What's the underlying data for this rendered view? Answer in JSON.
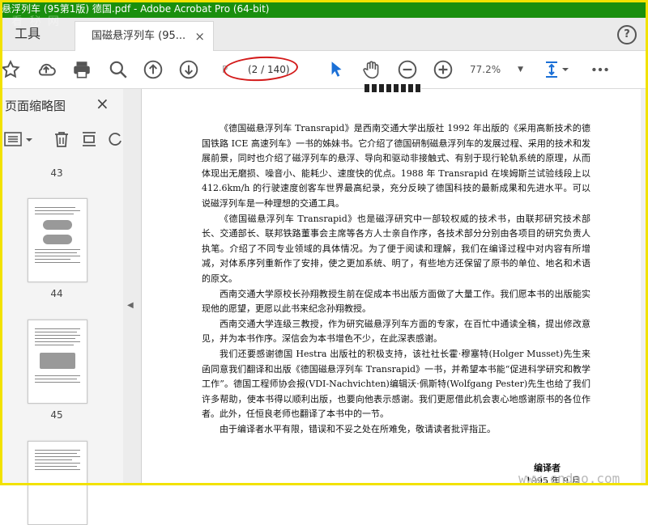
{
  "window": {
    "title": "悬浮列车 (95第1版)  德国.pdf - Adobe Acrobat Pro (64-bit)"
  },
  "tabs": {
    "tools_label": "工具",
    "doc_tab_label": "国磁悬浮列车 (95...",
    "close_glyph": "×",
    "help_glyph": "?"
  },
  "toolbar": {
    "current_page_hint": "P",
    "page_indicator": "(2 / 140)",
    "zoom": "77.2%",
    "zoom_arrow": "▼",
    "icons": [
      "star-icon",
      "cloud-upload-icon",
      "print-icon",
      "search-zoom-icon",
      "prev-page-icon",
      "next-page-icon",
      "select-cursor-icon",
      "hand-icon",
      "zoom-out-icon",
      "zoom-in-icon",
      "fit-page-icon",
      "more-icon"
    ]
  },
  "left_panel": {
    "title": "页面缩略图",
    "close_glyph": "×",
    "page_labels": [
      "43",
      "44",
      "45"
    ]
  },
  "document": {
    "paragraphs": [
      "《德国磁悬浮列车 Transrapid》是西南交通大学出版社 1992 年出版的《采用高新技术的德国铁路 ICE 高速列车》一书的姊妹书。它介绍了德国研制磁悬浮列车的发展过程、采用的技术和发展前景，同时也介绍了磁浮列车的悬浮、导向和驱动非接触式、有别于现行轮轨系统的原理，从而体现出无磨损、噪音小、能耗少、速度快的优点。1988 年 Transrapid 在埃姆斯兰试验线段上以 412.6km/h 的行驶速度创客车世界最高纪录，充分反映了德国科技的最新成果和先进水平。可以说磁浮列车是一种理想的交通工具。",
      "《德国磁悬浮列车 Transrapid》也是磁浮研究中一部较权威的技术书，由联邦研究技术部长、交通部长、联邦铁路董事会主席等各方人士亲自作序，各技术部分分别由各项目的研究负责人执笔。介绍了不同专业领域的具体情况。为了便于阅读和理解，我们在编译过程中对内容有所增减，对体系序列重新作了安排，使之更加系统、明了，有些地方还保留了原书的单位、地名和术语的原文。",
      "西南交通大学原校长孙翔教授生前在促成本书出版方面做了大量工作。我们愿本书的出版能实现他的愿望，更愿以此书来纪念孙翔教授。",
      "西南交通大学连级三教授，作为研究磁悬浮列车方面的专家，在百忙中通读全稿，提出修改意见，并为本书作序。深信会为本书增色不少，在此深表感谢。",
      "我们还要感谢德国 Hestra 出版社的积极支持，该社社长霍·穆塞特(Holger Musset)先生来函同意我们翻译和出版《德国磁悬浮列车 Transrapid》一书，并希望本书能“促进科学研究和教学工作”。德国工程师协会报(VDI-Nachvichten)编辑沃·佩斯特(Wolfgang Pester)先生也给了我们许多帮助，使本书得以顺利出版，也要向他表示感谢。我们更愿借此机会衷心地感谢原书的各位作者。此外，任恒良老师也翻译了本书中的一节。",
      "由于编译者水平有限，错误和不妥之处在所难免，敬请读者批评指正。"
    ],
    "signer": "编译者",
    "date": "1995 年 9 月"
  },
  "watermarks": {
    "top_left": "看 秘 网",
    "bottom_right": "www.cndao.com"
  }
}
